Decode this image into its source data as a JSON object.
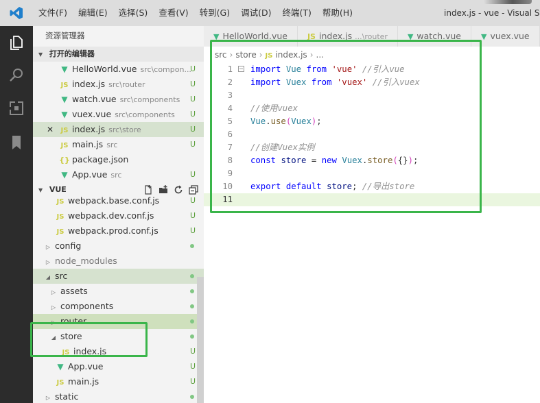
{
  "menu": [
    "文件(F)",
    "编辑(E)",
    "选择(S)",
    "查看(V)",
    "转到(G)",
    "调试(D)",
    "终端(T)",
    "帮助(H)"
  ],
  "window_title": "index.js - vue - Visual Studio Code",
  "sidebar": {
    "title": "资源管理器",
    "open_editors": {
      "header": "打开的编辑器",
      "items": [
        {
          "icon": "vue-file-icon",
          "name": "HelloWorld.vue",
          "path": "src\\compon...",
          "status": "U"
        },
        {
          "icon": "js-file-icon",
          "name": "index.js",
          "path": "src\\router",
          "status": "U"
        },
        {
          "icon": "vue-file-icon",
          "name": "watch.vue",
          "path": "src\\components",
          "status": "U"
        },
        {
          "icon": "vue-file-icon",
          "name": "vuex.vue",
          "path": "src\\components",
          "status": "U"
        },
        {
          "icon": "js-file-icon",
          "name": "index.js",
          "path": "src\\store",
          "status": "U",
          "active": true
        },
        {
          "icon": "js-file-icon",
          "name": "main.js",
          "path": "src",
          "status": "U"
        },
        {
          "icon": "json-file-icon",
          "name": "package.json",
          "path": "",
          "status": ""
        },
        {
          "icon": "vue-file-icon",
          "name": "App.vue",
          "path": "src",
          "status": "U"
        }
      ]
    },
    "project": {
      "header": "VUE",
      "items": [
        {
          "type": "file",
          "icon": "js-file-icon",
          "name": "webpack.base.conf.js",
          "status": "U",
          "indent": 1
        },
        {
          "type": "file",
          "icon": "js-file-icon",
          "name": "webpack.dev.conf.js",
          "status": "U",
          "indent": 1
        },
        {
          "type": "file",
          "icon": "js-file-icon",
          "name": "webpack.prod.conf.js",
          "status": "U",
          "indent": 1
        },
        {
          "type": "folder",
          "name": "config",
          "expanded": false,
          "status": "dot",
          "indent": 0
        },
        {
          "type": "folder",
          "name": "node_modules",
          "expanded": false,
          "status": "",
          "indent": 0,
          "muted": true
        },
        {
          "type": "folder",
          "name": "src",
          "expanded": true,
          "status": "dot",
          "indent": 0,
          "selected": true
        },
        {
          "type": "folder",
          "name": "assets",
          "expanded": false,
          "status": "dot",
          "indent": 1
        },
        {
          "type": "folder",
          "name": "components",
          "expanded": false,
          "status": "dot",
          "indent": 1
        },
        {
          "type": "folder",
          "name": "router",
          "expanded": false,
          "status": "dot",
          "indent": 1,
          "highlight": true
        },
        {
          "type": "folder",
          "name": "store",
          "expanded": true,
          "status": "dot",
          "indent": 1
        },
        {
          "type": "file",
          "icon": "js-file-icon",
          "name": "index.js",
          "status": "U",
          "indent": 2
        },
        {
          "type": "file",
          "icon": "vue-file-icon",
          "name": "App.vue",
          "status": "U",
          "indent": 1
        },
        {
          "type": "file",
          "icon": "js-file-icon",
          "name": "main.js",
          "status": "U",
          "indent": 1
        },
        {
          "type": "folder",
          "name": "static",
          "expanded": false,
          "status": "dot",
          "indent": 0
        }
      ]
    }
  },
  "tabs": [
    {
      "icon": "vue-file-icon",
      "label": "HelloWorld.vue",
      "path": ""
    },
    {
      "icon": "js-file-icon",
      "label": "index.js",
      "path": "...\\router"
    },
    {
      "icon": "vue-file-icon",
      "label": "watch.vue",
      "path": ""
    },
    {
      "icon": "vue-file-icon",
      "label": "vuex.vue",
      "path": ""
    }
  ],
  "breadcrumb": [
    "src",
    "store",
    "index.js",
    "..."
  ],
  "code_lines": [
    {
      "n": "1",
      "tokens": [
        [
          "kw",
          "import"
        ],
        [
          "pn",
          " "
        ],
        [
          "cls",
          "Vue"
        ],
        [
          "pn",
          " "
        ],
        [
          "kw",
          "from"
        ],
        [
          "pn",
          " "
        ],
        [
          "str",
          "'vue'"
        ],
        [
          "pn",
          " "
        ],
        [
          "cm",
          "//引入vue"
        ]
      ],
      "fold": true
    },
    {
      "n": "2",
      "tokens": [
        [
          "kw",
          "import"
        ],
        [
          "pn",
          " "
        ],
        [
          "cls",
          "Vuex"
        ],
        [
          "pn",
          " "
        ],
        [
          "kw",
          "from"
        ],
        [
          "pn",
          " "
        ],
        [
          "str",
          "'vuex'"
        ],
        [
          "pn",
          " "
        ],
        [
          "cm",
          "//引入vuex"
        ]
      ]
    },
    {
      "n": "3",
      "tokens": []
    },
    {
      "n": "4",
      "tokens": [
        [
          "cm",
          "//使用vuex"
        ]
      ]
    },
    {
      "n": "5",
      "tokens": [
        [
          "cls",
          "Vue"
        ],
        [
          "pn",
          "."
        ],
        [
          "fn",
          "use"
        ],
        [
          "br",
          "("
        ],
        [
          "cls",
          "Vuex"
        ],
        [
          "br",
          ")"
        ],
        [
          "pn",
          ";"
        ]
      ]
    },
    {
      "n": "6",
      "tokens": []
    },
    {
      "n": "7",
      "tokens": [
        [
          "cm",
          "//创建Vuex实例"
        ]
      ]
    },
    {
      "n": "8",
      "tokens": [
        [
          "kw",
          "const"
        ],
        [
          "pn",
          " "
        ],
        [
          "id",
          "store"
        ],
        [
          "pn",
          " = "
        ],
        [
          "kw",
          "new"
        ],
        [
          "pn",
          " "
        ],
        [
          "cls",
          "Vuex"
        ],
        [
          "pn",
          "."
        ],
        [
          "fn",
          "store"
        ],
        [
          "br",
          "("
        ],
        [
          "pn",
          "{}"
        ],
        [
          "br",
          ")"
        ],
        [
          "pn",
          ";"
        ]
      ]
    },
    {
      "n": "9",
      "tokens": []
    },
    {
      "n": "10",
      "tokens": [
        [
          "kw",
          "export"
        ],
        [
          "pn",
          " "
        ],
        [
          "kw",
          "default"
        ],
        [
          "pn",
          " "
        ],
        [
          "id",
          "store"
        ],
        [
          "pn",
          "; "
        ],
        [
          "cm",
          "//导出store"
        ]
      ]
    },
    {
      "n": "11",
      "tokens": [],
      "current": true
    }
  ]
}
